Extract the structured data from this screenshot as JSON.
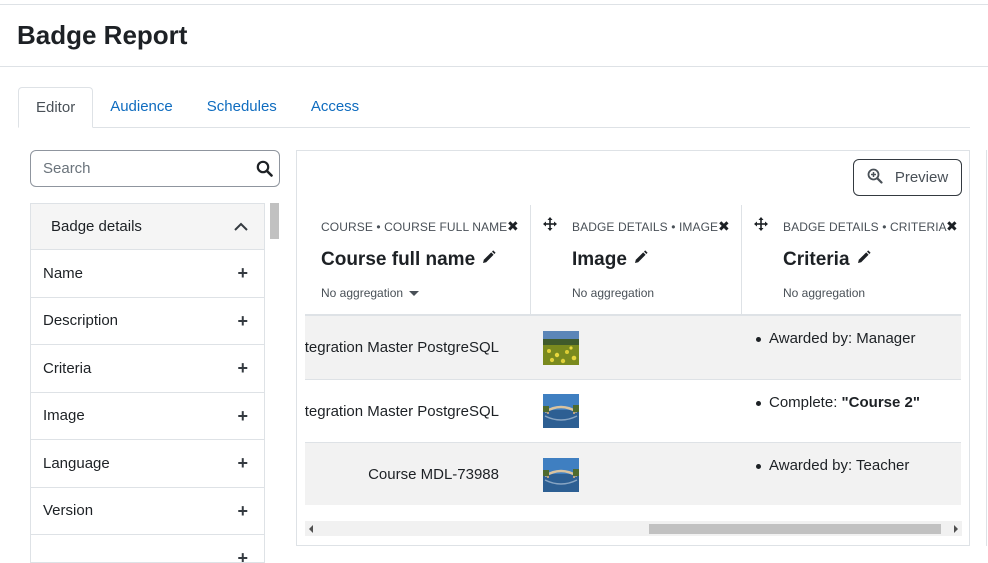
{
  "page": {
    "title": "Badge Report"
  },
  "tabs": [
    {
      "label": "Editor",
      "active": true
    },
    {
      "label": "Audience",
      "active": false
    },
    {
      "label": "Schedules",
      "active": false
    },
    {
      "label": "Access",
      "active": false
    }
  ],
  "search": {
    "placeholder": "Search",
    "icon": "search-icon"
  },
  "sidebar": {
    "header": "Badge details",
    "items": [
      {
        "label": "Name"
      },
      {
        "label": "Description"
      },
      {
        "label": "Criteria"
      },
      {
        "label": "Image"
      },
      {
        "label": "Language"
      },
      {
        "label": "Version"
      },
      {
        "label": ""
      }
    ]
  },
  "report": {
    "preview_label": "Preview",
    "columns": [
      {
        "crumb": "COURSE • COURSE FULL NAME",
        "title": "Course full name",
        "aggregation": "No aggregation"
      },
      {
        "crumb": "BADGE DETAILS • IMAGE",
        "title": "Image",
        "aggregation": "No aggregation"
      },
      {
        "crumb": "BADGE DETAILS • CRITERIA",
        "title": "Criteria",
        "aggregation": "No aggregation"
      }
    ],
    "rows": [
      {
        "course": "Integration Master PostgreSQL",
        "image": "field",
        "criteria_prefix": "Awarded by: ",
        "criteria_value": "Manager"
      },
      {
        "course": "Integration Master PostgreSQL",
        "image": "bridge",
        "criteria_prefix": "Complete: ",
        "criteria_value": "\"Course 2\""
      },
      {
        "course": "Course MDL-73988",
        "image": "bridge",
        "criteria_prefix": "Awarded by: ",
        "criteria_value": "Teacher"
      }
    ]
  },
  "colors": {
    "link": "#0f6cbf",
    "text": "#1d2125",
    "border": "#dee2e6",
    "stripe": "#f2f2f2"
  }
}
